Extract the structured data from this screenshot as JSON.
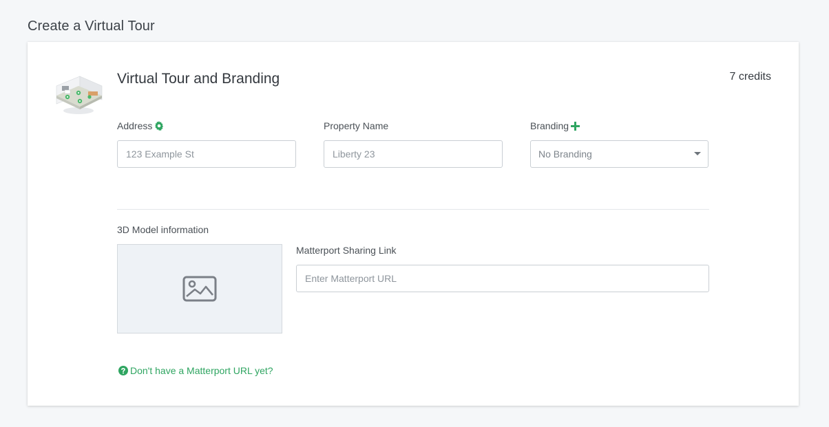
{
  "page": {
    "title": "Create a Virtual Tour"
  },
  "card": {
    "heading": "Virtual Tour and Branding",
    "credits": "7 credits"
  },
  "fields": {
    "address": {
      "label": "Address",
      "placeholder": "123 Example St",
      "icon": "gear-icon"
    },
    "property_name": {
      "label": "Property Name",
      "placeholder": "Liberty 23"
    },
    "branding": {
      "label": "Branding",
      "selected": "No Branding",
      "icon": "plus-icon"
    }
  },
  "model": {
    "label": "3D Model information",
    "thumbnail_icon": "image-placeholder-icon",
    "link_label": "Matterport Sharing Link",
    "link_placeholder": "Enter Matterport URL"
  },
  "help": {
    "link_text": "Don't have a Matterport URL yet?",
    "icon": "question-circle-icon"
  },
  "colors": {
    "accent": "#2fa561",
    "background": "#f5f7f9",
    "card": "#ffffff",
    "input_border": "#c9ced3"
  }
}
